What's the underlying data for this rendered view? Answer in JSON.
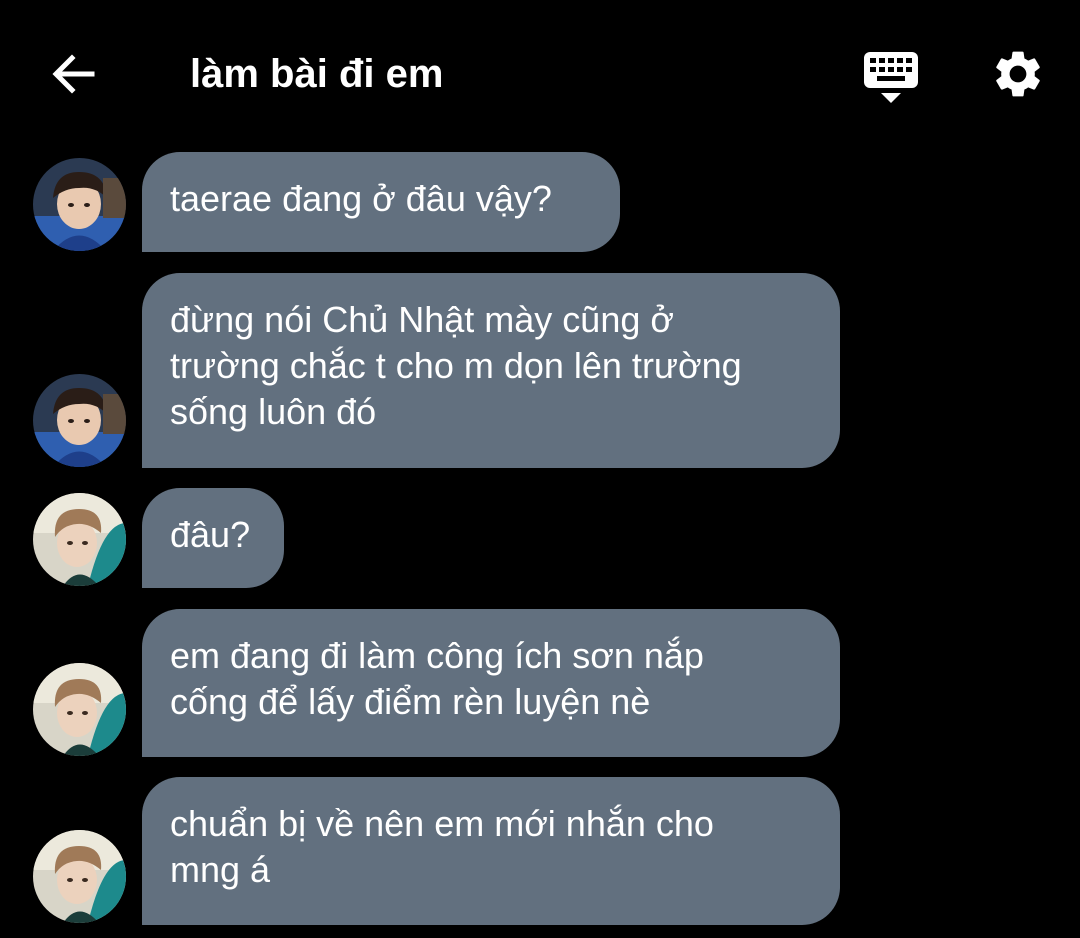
{
  "header": {
    "title": "làm bài đi em",
    "back_icon": "arrow-left-icon",
    "keyboard_icon": "keyboard-icon",
    "settings_icon": "gear-icon"
  },
  "colors": {
    "background": "#000000",
    "bubble": "#62707f",
    "text": "#ffffff"
  },
  "messages": [
    {
      "sender": "taerae",
      "text": "taerae đang ở đâu vậy?"
    },
    {
      "sender": "taerae",
      "text": "đừng nói Chủ Nhật mày cũng ở\ntrường chắc t cho m dọn lên trường\nsống luôn đó"
    },
    {
      "sender": "other",
      "text": "đâu?"
    },
    {
      "sender": "other",
      "text": "em đang đi làm công ích sơn nắp\ncống để lấy điểm rèn luyện nè"
    },
    {
      "sender": "other",
      "text": "chuẩn bị về nên em mới nhắn cho\nmng á"
    }
  ]
}
